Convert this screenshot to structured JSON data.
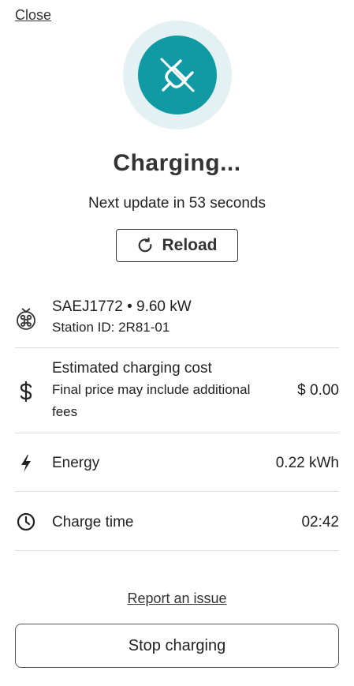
{
  "header": {
    "close_label": "Close"
  },
  "status": {
    "icon": "plug-icon",
    "title": "Charging...",
    "subtitle": "Next update in 53 seconds",
    "accent_color": "#0f9aa4"
  },
  "reload": {
    "icon": "reload-icon",
    "label": "Reload"
  },
  "details": {
    "connector": {
      "icon": "connector-icon",
      "line1": "SAEJ1772 • 9.60 kW",
      "line2": "Station ID: 2R81-01"
    },
    "cost": {
      "icon": "dollar-icon",
      "title": "Estimated charging cost",
      "note_line1": "Final price may include additional",
      "note_line2": "fees",
      "value": "$ 0.00"
    },
    "energy": {
      "icon": "lightning-icon",
      "label": "Energy",
      "value": "0.22 kWh"
    },
    "charge_time": {
      "icon": "clock-icon",
      "label": "Charge time",
      "value": "02:42"
    }
  },
  "footer": {
    "report_label": "Report an issue",
    "stop_label": "Stop charging"
  }
}
